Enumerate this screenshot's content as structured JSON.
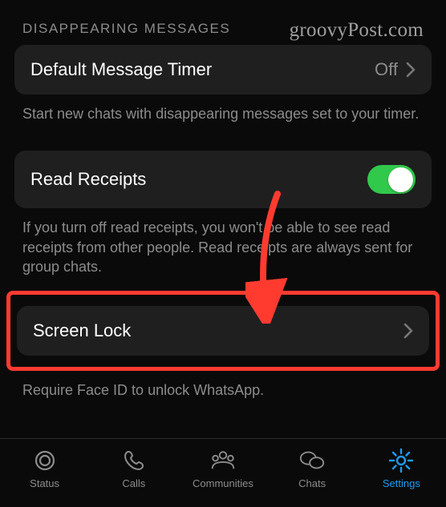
{
  "watermark": "groovyPost.com",
  "sections": {
    "disappearing": {
      "header": "DISAPPEARING MESSAGES",
      "timer_label": "Default Message Timer",
      "timer_value": "Off",
      "footer": "Start new chats with disappearing messages set to your timer."
    },
    "read_receipts": {
      "label": "Read Receipts",
      "enabled": true,
      "footer": "If you turn off read receipts, you won't be able to see read receipts from other people. Read receipts are always sent for group chats."
    },
    "screen_lock": {
      "label": "Screen Lock",
      "footer": "Require Face ID to unlock WhatsApp."
    }
  },
  "tabs": {
    "status": "Status",
    "calls": "Calls",
    "communities": "Communities",
    "chats": "Chats",
    "settings": "Settings"
  }
}
